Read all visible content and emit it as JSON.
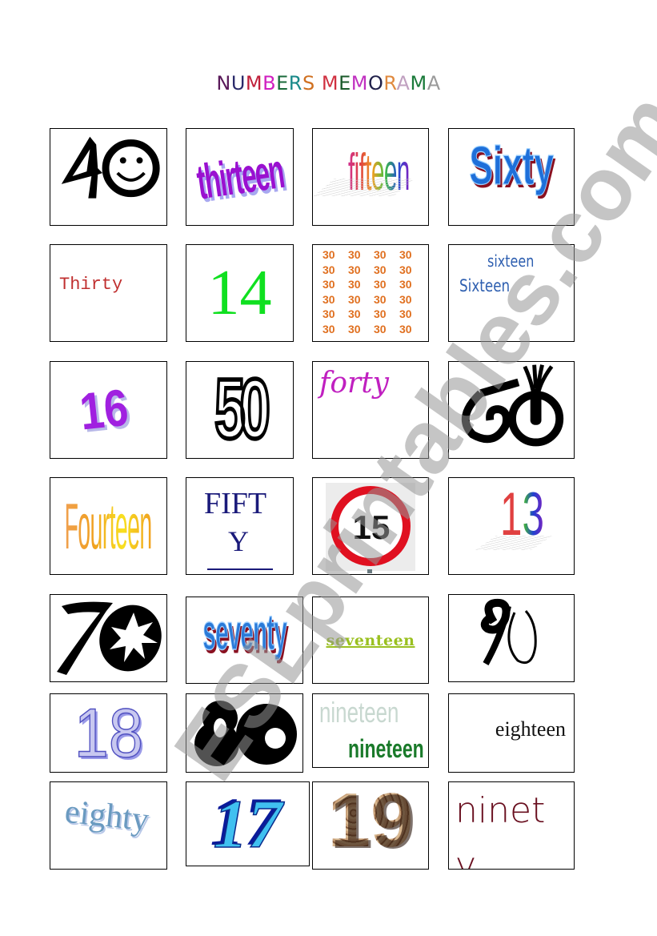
{
  "title": {
    "text": "NUMBERS MEMORAMA",
    "letters": [
      {
        "ch": "N",
        "color": "#5a1a5a"
      },
      {
        "ch": "U",
        "color": "#2a2a6a"
      },
      {
        "ch": "M",
        "color": "#c0203a"
      },
      {
        "ch": "B",
        "color": "#d020c0"
      },
      {
        "ch": "E",
        "color": "#1a6a3a"
      },
      {
        "ch": "R",
        "color": "#1a8a8a"
      },
      {
        "ch": "S",
        "color": "#d07020"
      },
      {
        "ch": " ",
        "color": "#000000"
      },
      {
        "ch": "M",
        "color": "#d03040"
      },
      {
        "ch": "E",
        "color": "#1a5a2a"
      },
      {
        "ch": "M",
        "color": "#c030c0"
      },
      {
        "ch": "O",
        "color": "#20204a"
      },
      {
        "ch": "R",
        "color": "#e08a40"
      },
      {
        "ch": "A",
        "color": "#c0a0c0"
      },
      {
        "ch": "M",
        "color": "#1a7a3a"
      },
      {
        "ch": "A",
        "color": "#9a9a9a"
      }
    ]
  },
  "watermark": "ESLprintables.com",
  "cards": [
    {
      "text": "40",
      "kind": "black-stylized-number-with-smiley"
    },
    {
      "text": "thirteen",
      "kind": "purple-wordart",
      "color": "#9a10d0"
    },
    {
      "text": "fifteen",
      "kind": "rainbow-wordart"
    },
    {
      "text": "Sixty",
      "kind": "blue-red-wordart",
      "color": "#1e6fd9"
    },
    {
      "text": "Thirty",
      "kind": "red-monospace",
      "color": "#c03030"
    },
    {
      "text": "14",
      "kind": "green-serif",
      "color": "#10e020"
    },
    {
      "text": "30",
      "kind": "orange-grid",
      "color": "#e07020",
      "rows": 6,
      "cols": 4
    },
    {
      "text": "sixteen",
      "text2": "Sixteen",
      "kind": "blue-condensed",
      "color": "#2e5fb0"
    },
    {
      "text": "16",
      "kind": "purple-wordart",
      "color": "#a020e0"
    },
    {
      "text": "50",
      "kind": "black-outline-number"
    },
    {
      "text": "forty",
      "kind": "magenta-handwriting",
      "color": "#c020c0"
    },
    {
      "text": "60",
      "kind": "black-stylized-number"
    },
    {
      "text": "Fourteen",
      "kind": "orange-yellow-wordart",
      "color": "#f0a020"
    },
    {
      "text": "FIFT",
      "text2": "Y",
      "kind": "navy-serif",
      "color": "#1a1a7a"
    },
    {
      "text": "15",
      "kind": "speed-limit-sign",
      "ring_color": "#e01020"
    },
    {
      "text": "13",
      "kind": "rainbow-wordart"
    },
    {
      "text": "70",
      "kind": "black-stylized-number-with-starburst"
    },
    {
      "text": "seventy",
      "kind": "blue-red-wordart",
      "color": "#2a7ad8"
    },
    {
      "text": "seventeen",
      "kind": "green-underlined-serif",
      "color": "#9ac020"
    },
    {
      "text": "90",
      "kind": "black-brush-number"
    },
    {
      "text": "18",
      "kind": "lavender-outline-number",
      "color": "#9a9ae8"
    },
    {
      "text": "80",
      "kind": "black-bold-number"
    },
    {
      "text": "nineteen",
      "text2": "nineteen",
      "kind": "green-condensed",
      "color": "#1a7a2a",
      "ghost_color": "#c8d8d0"
    },
    {
      "text": "eighteen",
      "kind": "black-serif",
      "color": "#111111"
    },
    {
      "text": "eighty",
      "kind": "teal-wavy-wordart",
      "color": "#6a9ac0"
    },
    {
      "text": "17",
      "kind": "blue-3d-number",
      "color": "#40c0f0"
    },
    {
      "text": "19",
      "kind": "stone-textured-number",
      "color": "#a88058"
    },
    {
      "text": "ninet",
      "text2": "y",
      "kind": "darkred-thin",
      "color": "#6a1020"
    }
  ]
}
